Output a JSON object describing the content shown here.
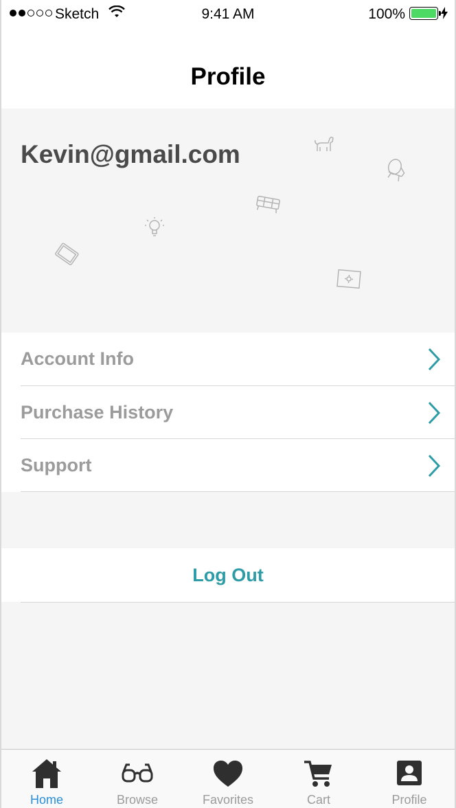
{
  "status_bar": {
    "carrier": "Sketch",
    "time": "9:41 AM",
    "battery": "100%"
  },
  "nav": {
    "title": "Profile"
  },
  "profile": {
    "email": "Kevin@gmail.com"
  },
  "menu": {
    "items": [
      {
        "label": "Account Info",
        "icon": "chevron-right-icon"
      },
      {
        "label": "Purchase History",
        "icon": "chevron-right-icon"
      },
      {
        "label": "Support",
        "icon": "chevron-right-icon"
      }
    ]
  },
  "logout": {
    "label": "Log Out"
  },
  "tabbar": {
    "tabs": [
      {
        "label": "Home",
        "icon": "home-icon",
        "active": true
      },
      {
        "label": "Browse",
        "icon": "glasses-icon",
        "active": false
      },
      {
        "label": "Favorites",
        "icon": "heart-icon",
        "active": false
      },
      {
        "label": "Cart",
        "icon": "cart-icon",
        "active": false
      },
      {
        "label": "Profile",
        "icon": "profile-card-icon",
        "active": false
      }
    ]
  },
  "colors": {
    "accent": "#2e9ca6",
    "tab_active": "#2b8fd6",
    "muted_text": "#9b9b9b",
    "battery": "#4cd964"
  }
}
